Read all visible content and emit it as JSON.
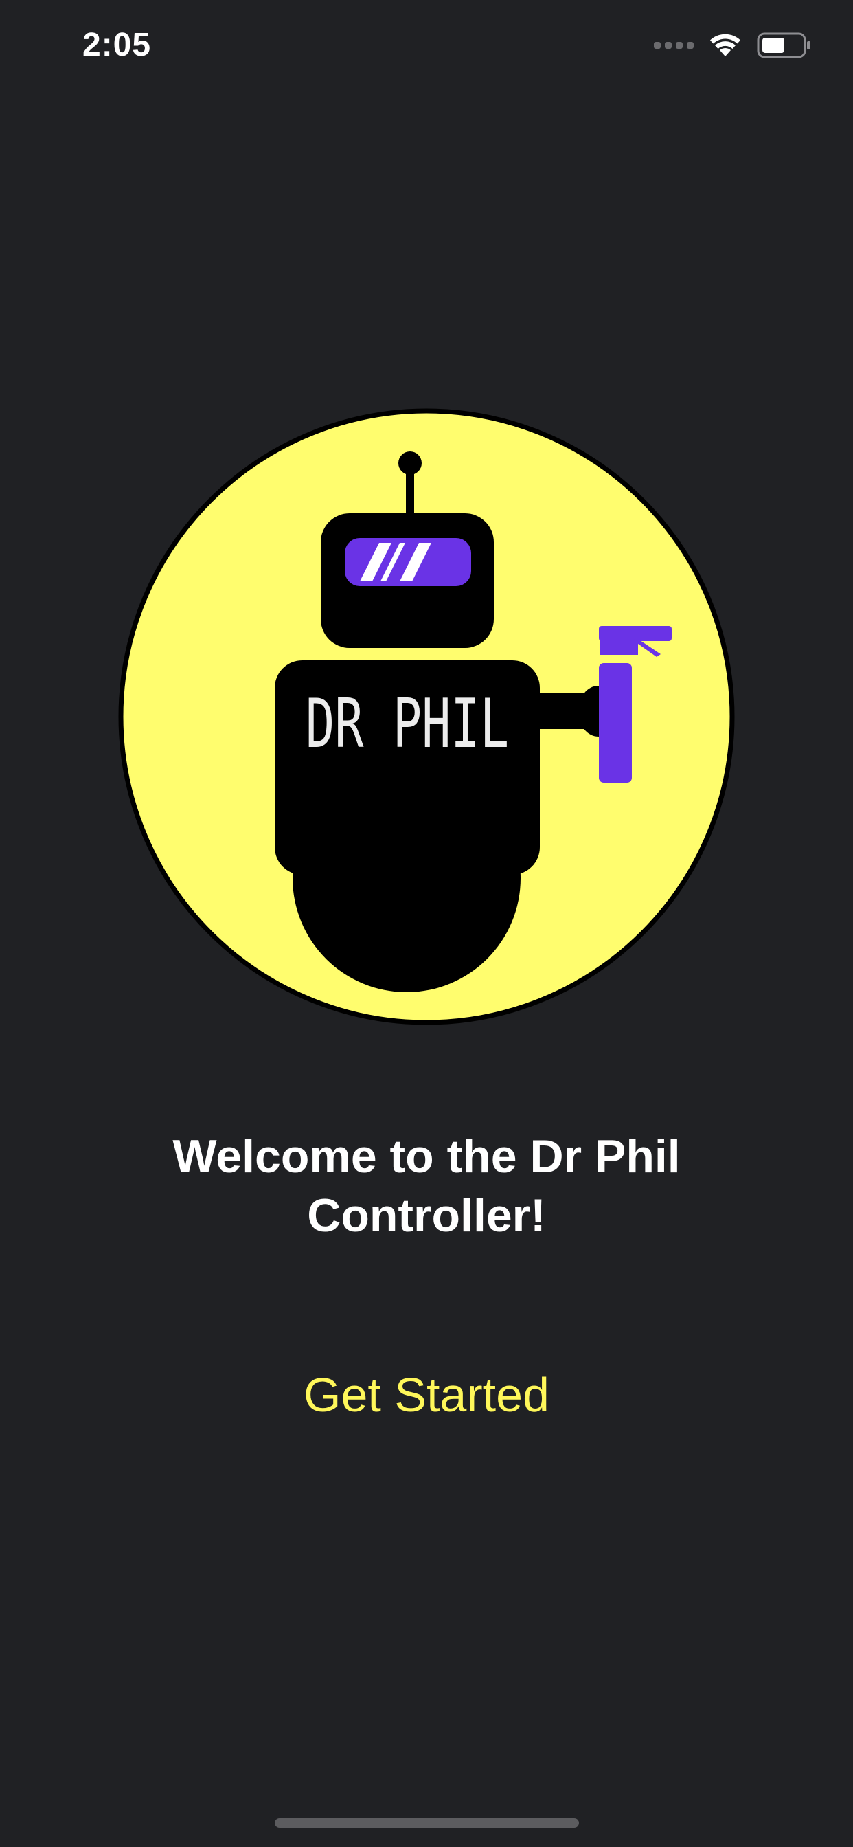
{
  "status_bar": {
    "time": "2:05",
    "icons": [
      "cellular-signal-icon",
      "wifi-icon",
      "battery-icon"
    ]
  },
  "logo": {
    "icon": "robot-logo-icon",
    "label": "DR PHIL",
    "colors": {
      "background": "#fffd6e",
      "body": "#000000",
      "visor": "#6a33e6",
      "tool": "#6a33e6",
      "text": "#ececec"
    }
  },
  "welcome": {
    "title": "Welcome to the Dr Phil Controller!"
  },
  "actions": {
    "get_started_label": "Get Started",
    "accent_color": "#fff75a"
  },
  "theme": {
    "background": "#202124"
  }
}
